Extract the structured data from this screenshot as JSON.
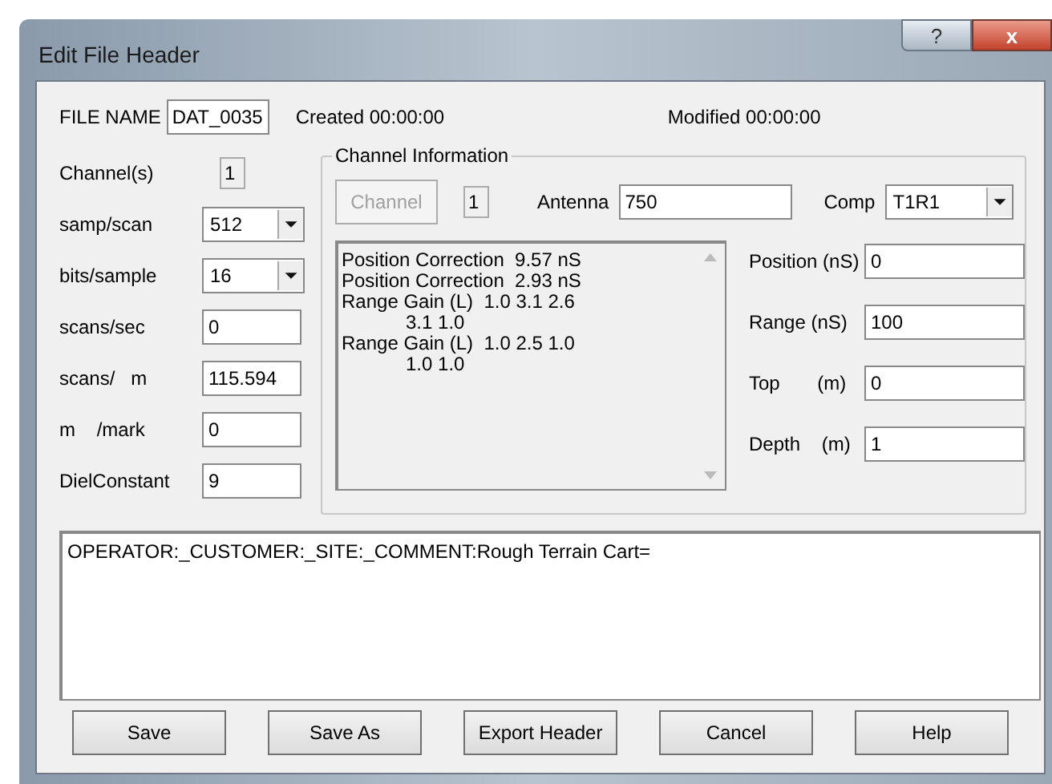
{
  "window": {
    "title": "Edit File Header",
    "help_button": "?",
    "close_button": "x"
  },
  "file_name": {
    "label": "FILE NAME",
    "value": "DAT_0035"
  },
  "created": "Created 00:00:00",
  "modified": "Modified 00:00:00",
  "settings": [
    {
      "kind": "readonly",
      "label": "Channel(s)",
      "value": "1"
    },
    {
      "kind": "select",
      "label": "samp/scan",
      "value": "512"
    },
    {
      "kind": "select",
      "label": "bits/sample",
      "value": "16"
    },
    {
      "kind": "input",
      "label": "scans/sec",
      "value": "0"
    },
    {
      "kind": "input",
      "label": "scans/   m",
      "value": "115.594"
    },
    {
      "kind": "input",
      "label": "m    /mark",
      "value": "0"
    },
    {
      "kind": "input",
      "label": "DielConstant",
      "value": "9"
    }
  ],
  "channel_info": {
    "title": "Channel Information",
    "channel_button": {
      "label": "Channel",
      "disabled": true
    },
    "channel_number": "1",
    "antenna": {
      "label": "Antenna",
      "value": "750"
    },
    "comp": {
      "label": "Comp",
      "value": "T1R1"
    },
    "list": [
      {
        "text": "Position Correction  9.57 nS"
      },
      {
        "text": "Position Correction  2.93 nS"
      },
      {
        "text": "Range Gain (L)  1.0 3.1 2.6",
        "continuation": "3.1 1.0"
      },
      {
        "text": "Range Gain (L)  1.0 2.5 1.0",
        "continuation": "1.0 1.0"
      }
    ],
    "fields": [
      {
        "label": "Position (nS)",
        "value": "0"
      },
      {
        "label": "Range (nS)",
        "value": "100"
      },
      {
        "label": "Top       (m)",
        "value": "0"
      },
      {
        "label": "Depth    (m)",
        "value": "1"
      }
    ]
  },
  "comment": "OPERATOR:_CUSTOMER:_SITE:_COMMENT:Rough Terrain Cart=",
  "buttons": [
    "Save",
    "Save As",
    "Export Header",
    "Cancel",
    "Help"
  ]
}
